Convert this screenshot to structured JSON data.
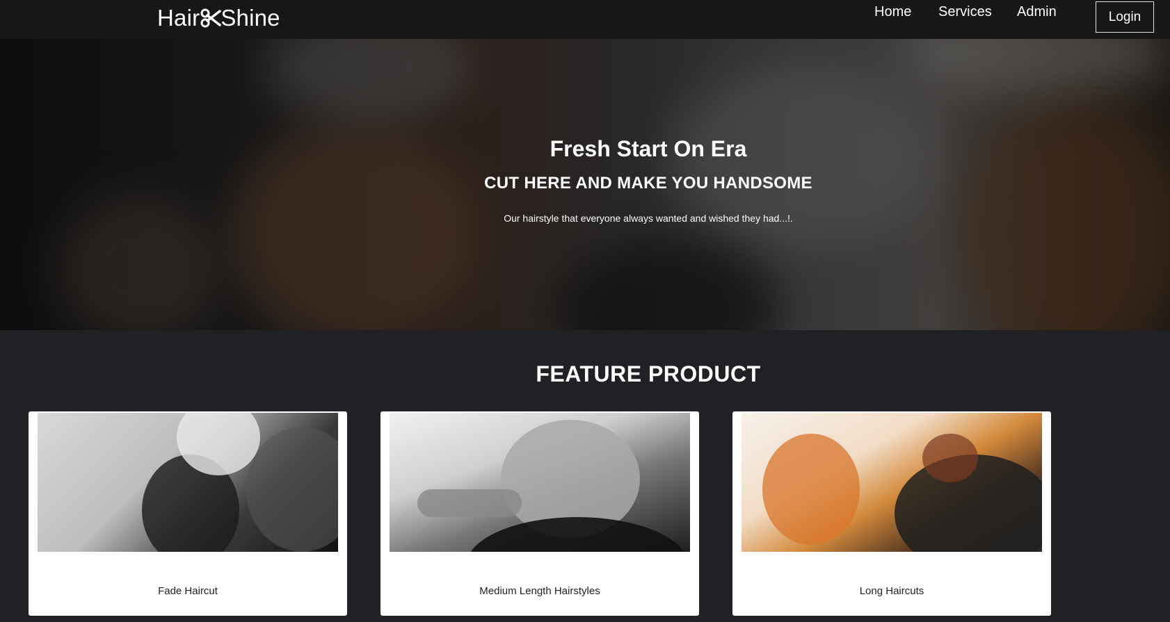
{
  "nav": {
    "logo_left": "Hair",
    "logo_right": "Shine",
    "logo_icon": "scissors-icon",
    "links": [
      "Home",
      "Services",
      "Admin"
    ],
    "login_label": "Login"
  },
  "hero": {
    "title": "Fresh Start On Era",
    "subtitle": "CUT HERE AND MAKE YOU HANDSOME",
    "tagline": "Our hairstyle that everyone always wanted and wished they had...!."
  },
  "feature": {
    "title": "FEATURE PRODUCT",
    "cards": [
      {
        "title": "Fade Haircut"
      },
      {
        "title": "Medium Length Hairstyles"
      },
      {
        "title": "Long Haircuts"
      }
    ]
  },
  "colors": {
    "navbar": "#181717",
    "page_background": "#1f2125",
    "card_background": "#ffffff",
    "text_light": "#ffffff",
    "text_dark": "#222222"
  }
}
